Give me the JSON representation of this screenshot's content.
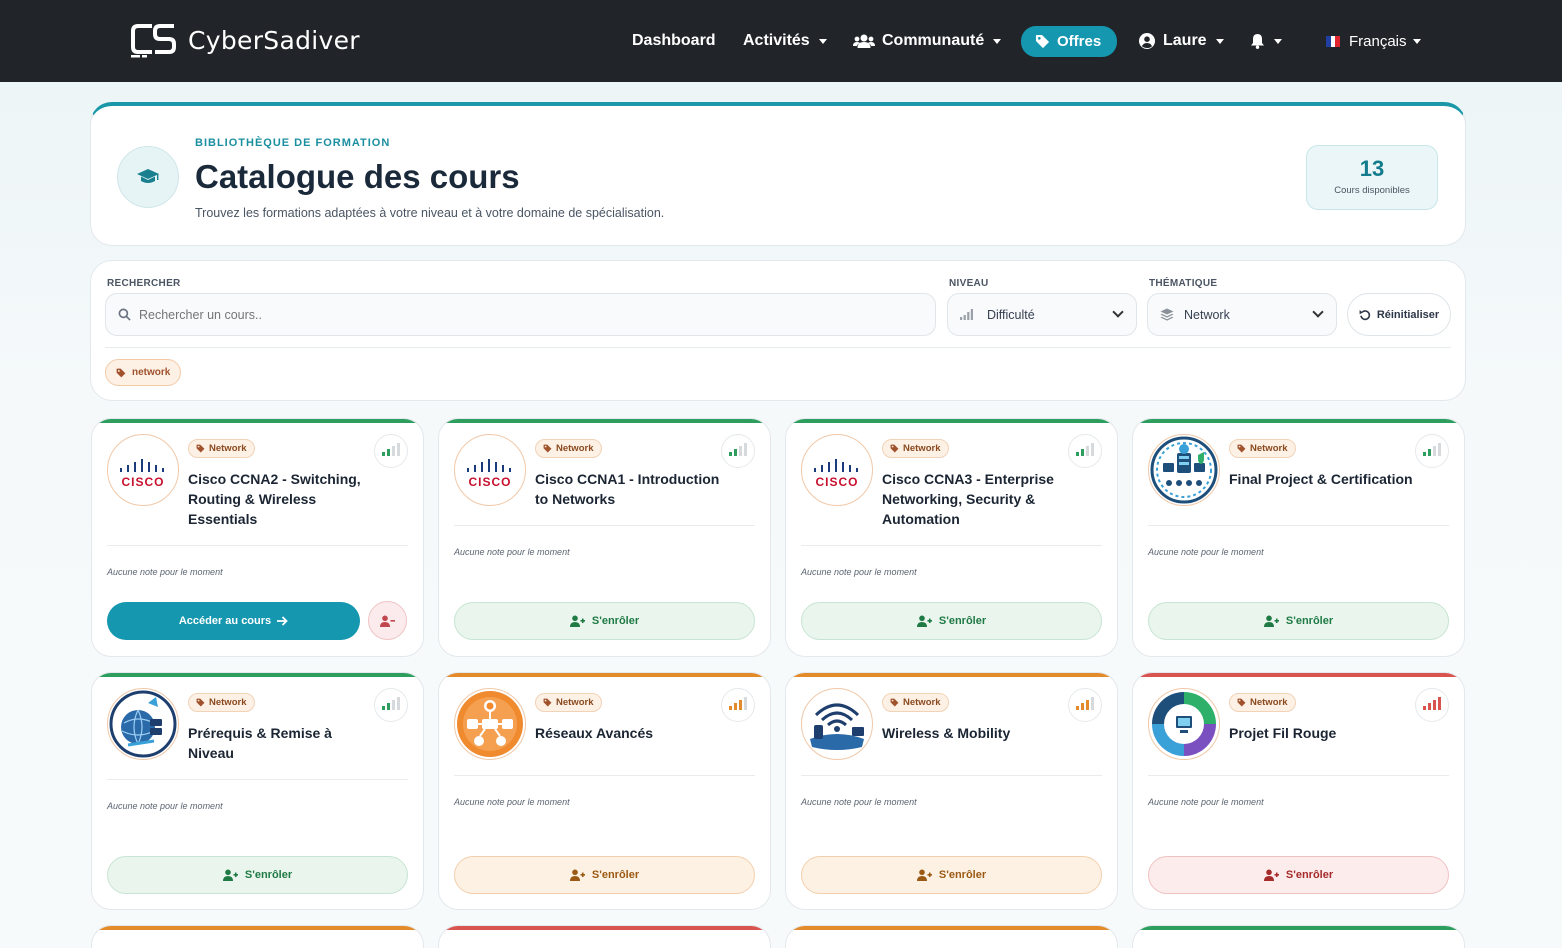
{
  "app": {
    "brand": "CyberSadiver"
  },
  "nav": {
    "dashboard": "Dashboard",
    "activities": "Activités",
    "community": "Communauté",
    "offers": "Offres",
    "user": "Laure",
    "language": "Français"
  },
  "header": {
    "eyebrow": "BIBLIOTHÈQUE DE FORMATION",
    "title": "Catalogue des cours",
    "subtitle": "Trouvez les formations adaptées à votre niveau et à votre domaine de spécialisation.",
    "count": "13",
    "count_label": "Cours disponibles"
  },
  "filters": {
    "search_label": "RECHERCHER",
    "search_placeholder": "Rechercher un cours..",
    "level_label": "NIVEAU",
    "level_value": "Difficulté",
    "theme_label": "THÉMATIQUE",
    "theme_value": "Network",
    "reset": "Réinitialiser",
    "active_tag": "network"
  },
  "colors": {
    "accent": "#1597b0",
    "easy": "#2e9e5e",
    "medium": "#e38a2a",
    "hard": "#d9534f"
  },
  "courses": [
    {
      "category": "Network",
      "title": "Cisco CCNA2 - Switching, Routing & Wireless Essentials",
      "rating": "Aucune note pour le moment",
      "action": "Accéder au cours",
      "level": "easy",
      "logo": "cisco-logo",
      "enrolled": true
    },
    {
      "category": "Network",
      "title": "Cisco CCNA1 - Introduction to Networks",
      "rating": "Aucune note pour le moment",
      "action": "S'enrôler",
      "level": "easy",
      "logo": "cisco-logo",
      "enrolled": false
    },
    {
      "category": "Network",
      "title": "Cisco CCNA3 - Enterprise Networking, Security & Automation",
      "rating": "Aucune note pour le moment",
      "action": "S'enrôler",
      "level": "easy",
      "logo": "cisco-logo",
      "enrolled": false
    },
    {
      "category": "Network",
      "title": "Final Project & Certification",
      "rating": "Aucune note pour le moment",
      "action": "S'enrôler",
      "level": "easy",
      "logo": "project-logo",
      "enrolled": false
    },
    {
      "category": "Network",
      "title": "Prérequis & Remise à Niveau",
      "rating": "Aucune note pour le moment",
      "action": "S'enrôler",
      "level": "easy",
      "logo": "globe-logo",
      "enrolled": false
    },
    {
      "category": "Network",
      "title": "Réseaux Avancés",
      "rating": "Aucune note pour le moment",
      "action": "S'enrôler",
      "level": "medium",
      "logo": "network-logo",
      "enrolled": false
    },
    {
      "category": "Network",
      "title": "Wireless & Mobility",
      "rating": "Aucune note pour le moment",
      "action": "S'enrôler",
      "level": "medium",
      "logo": "wireless-logo",
      "enrolled": false
    },
    {
      "category": "Network",
      "title": "Projet Fil Rouge",
      "rating": "Aucune note pour le moment",
      "action": "S'enrôler",
      "level": "hard",
      "logo": "pipeline-logo",
      "enrolled": false
    }
  ]
}
